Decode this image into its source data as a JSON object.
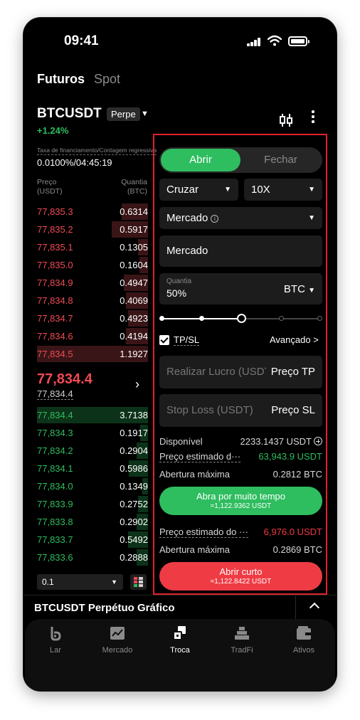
{
  "status": {
    "time": "09:41"
  },
  "header": {
    "tab_futures": "Futuros",
    "tab_spot": "Spot"
  },
  "instrument": {
    "symbol": "BTCUSDT",
    "badge": "Perpe",
    "change": "+1.24%",
    "funding_label": "Taxa de financiamento/Contagem regressiva",
    "funding_value": "0.0100%/04:45:19"
  },
  "orderbook": {
    "price_header_1": "Preço",
    "price_header_2": "(USDT)",
    "qty_header_1": "Quantia",
    "qty_header_2": "(BTC)",
    "asks": [
      {
        "price": "77,835.3",
        "qty": "0.6314",
        "depth": 0.24
      },
      {
        "price": "77,835.2",
        "qty": "0.5917",
        "depth": 0.33
      },
      {
        "price": "77,835.1",
        "qty": "0.1305",
        "depth": 0.09
      },
      {
        "price": "77,835.0",
        "qty": "0.1604",
        "depth": 0.08
      },
      {
        "price": "77,834.9",
        "qty": "0.4947",
        "depth": 0.22
      },
      {
        "price": "77,834.8",
        "qty": "0.4069",
        "depth": 0.2
      },
      {
        "price": "77,834.7",
        "qty": "0.4923",
        "depth": 0.18
      },
      {
        "price": "77,834.6",
        "qty": "0.4194",
        "depth": 0.2
      },
      {
        "price": "77,834.5",
        "qty": "1.1927",
        "depth": 1.0
      }
    ],
    "mid_price": "77,834.4",
    "mid_sub": "77,834.4",
    "bids": [
      {
        "price": "77,834.4",
        "qty": "3.7138",
        "depth": 1.0
      },
      {
        "price": "77,834.3",
        "qty": "0.1917",
        "depth": 0.07
      },
      {
        "price": "77,834.2",
        "qty": "0.2904",
        "depth": 0.1
      },
      {
        "price": "77,834.1",
        "qty": "0.5986",
        "depth": 0.17
      },
      {
        "price": "77,834.0",
        "qty": "0.1349",
        "depth": 0.05
      },
      {
        "price": "77,833.9",
        "qty": "0.2752",
        "depth": 0.09
      },
      {
        "price": "77,833.8",
        "qty": "0.2902",
        "depth": 0.1
      },
      {
        "price": "77,833.7",
        "qty": "0.5492",
        "depth": 0.18
      },
      {
        "price": "77,833.6",
        "qty": "0.2888",
        "depth": 0.1
      }
    ],
    "depth_value": "0.1"
  },
  "order_form": {
    "open_label": "Abrir",
    "close_label": "Fechar",
    "margin_mode": "Cruzar",
    "leverage": "10X",
    "order_type": "Mercado",
    "price_value": "Mercado",
    "qty_label": "Quantia",
    "qty_value": "50%",
    "qty_unit": "BTC",
    "slider_percent": 50,
    "tpsl_label": "TP/SL",
    "advanced_label": "Avançado >",
    "tp_placeholder": "Realizar Lucro (USDT)",
    "tp_suffix": "Preço TP",
    "sl_placeholder": "Stop Loss (USDT)",
    "sl_suffix": "Preço SL",
    "available_label": "Disponível",
    "available_value": "2233.1437 USDT",
    "est_long_label": "Preço estimado d···",
    "est_long_value": "63,943.9 USDT",
    "max_long_label": "Abertura máxima",
    "max_long_value": "0.2812 BTC",
    "long_button": "Abra por muito tempo",
    "long_button_sub": "≈1,122.9362 USDT",
    "est_short_label": "Preço estimado do ···",
    "est_short_value": "6,976.0 USDT",
    "max_short_label": "Abertura máxima",
    "max_short_value": "0.2869 BTC",
    "short_button": "Abrir curto",
    "short_button_sub": "≈1,122.8422 USDT"
  },
  "chart_bar": {
    "title": "BTCUSDT Perpétuo Gráfico"
  },
  "nav": {
    "items": [
      {
        "label": "Lar",
        "icon": "home-icon"
      },
      {
        "label": "Mercado",
        "icon": "market-icon"
      },
      {
        "label": "Troca",
        "icon": "trade-icon"
      },
      {
        "label": "TradFi",
        "icon": "tradfi-icon"
      },
      {
        "label": "Ativos",
        "icon": "wallet-icon"
      }
    ],
    "active_index": 2
  },
  "colors": {
    "green": "#2ebd5f",
    "red": "#ef4a55",
    "highlight": "#e0202a"
  }
}
